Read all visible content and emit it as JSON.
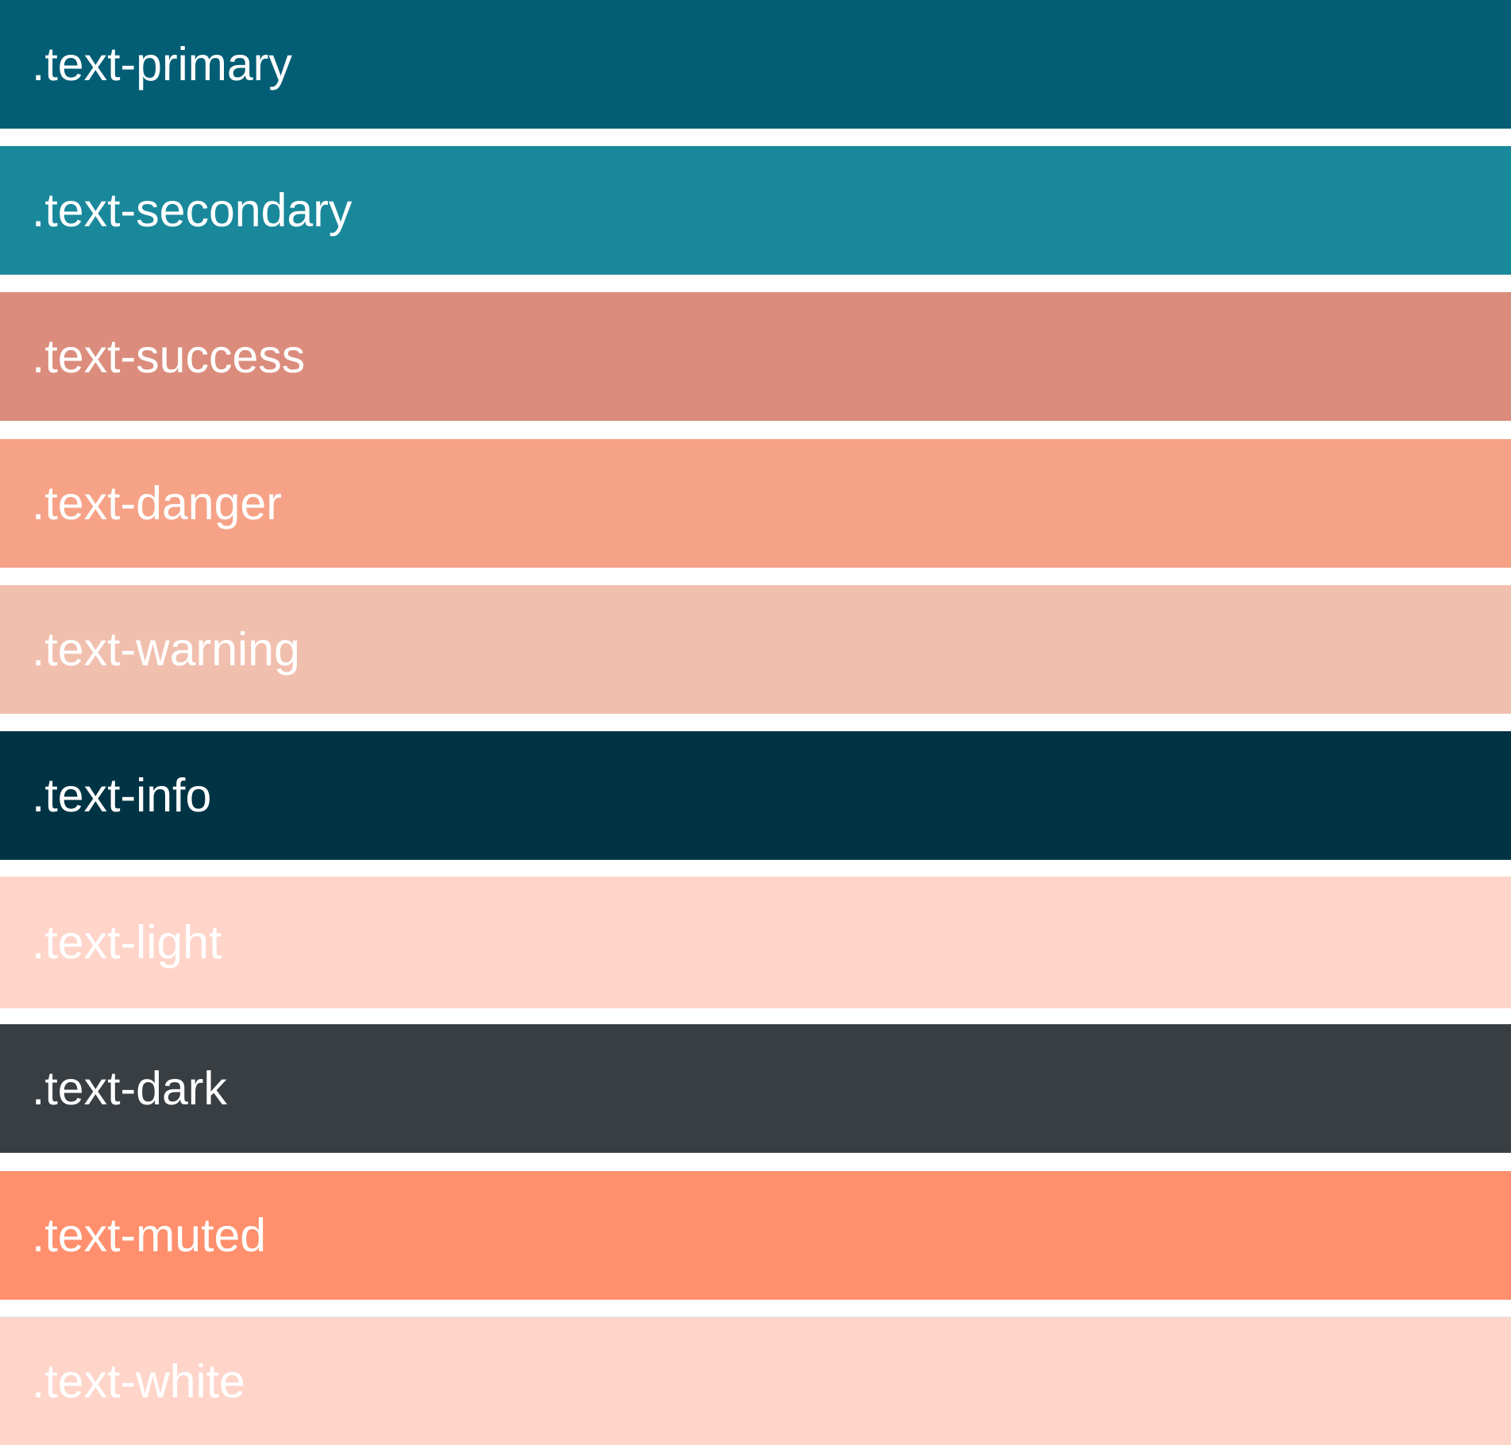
{
  "swatches": [
    {
      "label": ".text-primary",
      "color": "#035e75"
    },
    {
      "label": ".text-secondary",
      "color": "#1a889b"
    },
    {
      "label": ".text-success",
      "color": "#db8c7c"
    },
    {
      "label": ".text-danger",
      "color": "#f6a287"
    },
    {
      "label": ".text-warning",
      "color": "#f1bfae"
    },
    {
      "label": ".text-info",
      "color": "#003445"
    },
    {
      "label": ".text-light",
      "color": "#ffd5ca"
    },
    {
      "label": ".text-dark",
      "color": "#393e42"
    },
    {
      "label": ".text-muted",
      "color": "#ff8f6d"
    },
    {
      "label": ".text-white",
      "color": "#ffd5ca"
    }
  ]
}
